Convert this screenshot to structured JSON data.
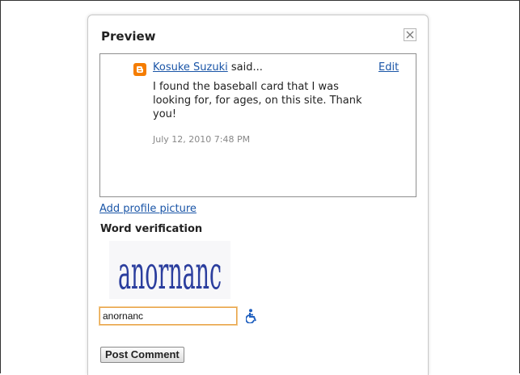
{
  "dialog": {
    "title": "Preview",
    "close_icon": "close-icon"
  },
  "comment": {
    "author": "Kosuke Suzuki",
    "said": " said...",
    "edit_label": "Edit",
    "body": "I found the baseball card that I was looking for, for ages, on this site. Thank you!",
    "timestamp": "July 12, 2010 7:48 PM",
    "author_icon": "blogger-icon",
    "icon_color": "#f57d00"
  },
  "profile": {
    "add_picture_label": "Add profile picture"
  },
  "verification": {
    "label": "Word verification",
    "captcha_word": "anornanc",
    "input_value": "anornanc",
    "accessibility_icon": "wheelchair-icon"
  },
  "actions": {
    "post_label": "Post Comment"
  },
  "colors": {
    "link": "#1a55a7",
    "input_focus_border": "#e8a44a",
    "captcha_ink": "#2b3e9e"
  }
}
